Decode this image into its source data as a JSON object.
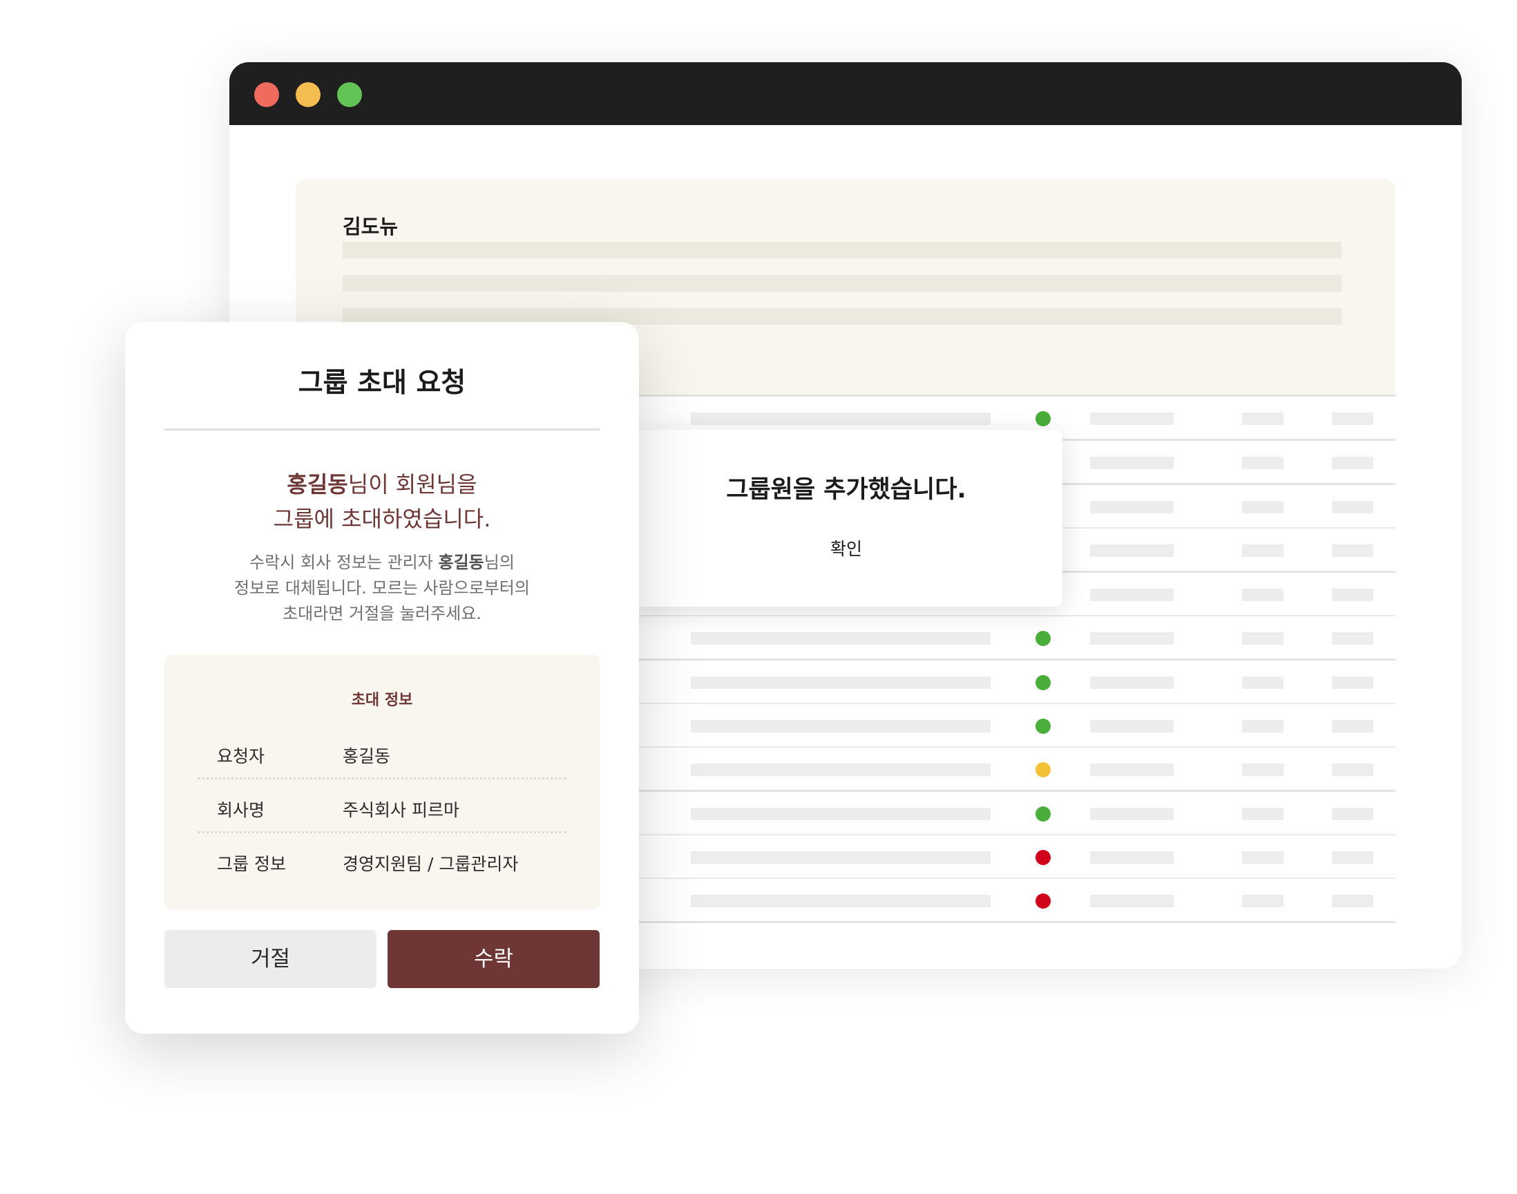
{
  "window": {
    "controls": [
      "close",
      "minimize",
      "maximize"
    ]
  },
  "profile": {
    "name": "김도뉴"
  },
  "table": {
    "rows": [
      {
        "status_color": "#4aae3a"
      },
      {
        "status_color": "#4aae3a"
      },
      {
        "status_color": "#4aae3a"
      },
      {
        "status_color": "#4aae3a"
      },
      {
        "status_color": "#4aae3a"
      },
      {
        "status_color": "#4aae3a"
      },
      {
        "status_color": "#4aae3a"
      },
      {
        "status_color": "#4aae3a"
      },
      {
        "status_color": "#f4c136"
      },
      {
        "status_color": "#4aae3a"
      },
      {
        "status_color": "#d0021b"
      },
      {
        "status_color": "#d0021b"
      }
    ]
  },
  "toast": {
    "message": "그룹원을 추가했습니다.",
    "confirm_label": "확인"
  },
  "invite_modal": {
    "title": "그룹 초대 요청",
    "headline_name": "홍길동",
    "headline_line1_rest": "님이 회원님을",
    "headline_line2": "그룹에 초대하였습니다.",
    "desc_line1_pre": "수락시 회사 정보는 관리자 ",
    "desc_line1_name": "홍길동",
    "desc_line1_post": "님의",
    "desc_line2": "정보로 대체됩니다. 모르는 사람으로부터의",
    "desc_line3": "초대라면 거절을 눌러주세요.",
    "info_title": "초대 정보",
    "info_rows": [
      {
        "label": "요청자",
        "value": "홍길동"
      },
      {
        "label": "회사명",
        "value": "주식회사 피르마"
      },
      {
        "label": "그룹 정보",
        "value": "경영지원팀 / 그룹관리자"
      }
    ],
    "decline_label": "거절",
    "accept_label": "수락"
  },
  "colors": {
    "brand": "#6e3735",
    "status_ok": "#4aae3a",
    "status_warn": "#f4c136",
    "status_error": "#d0021b"
  }
}
